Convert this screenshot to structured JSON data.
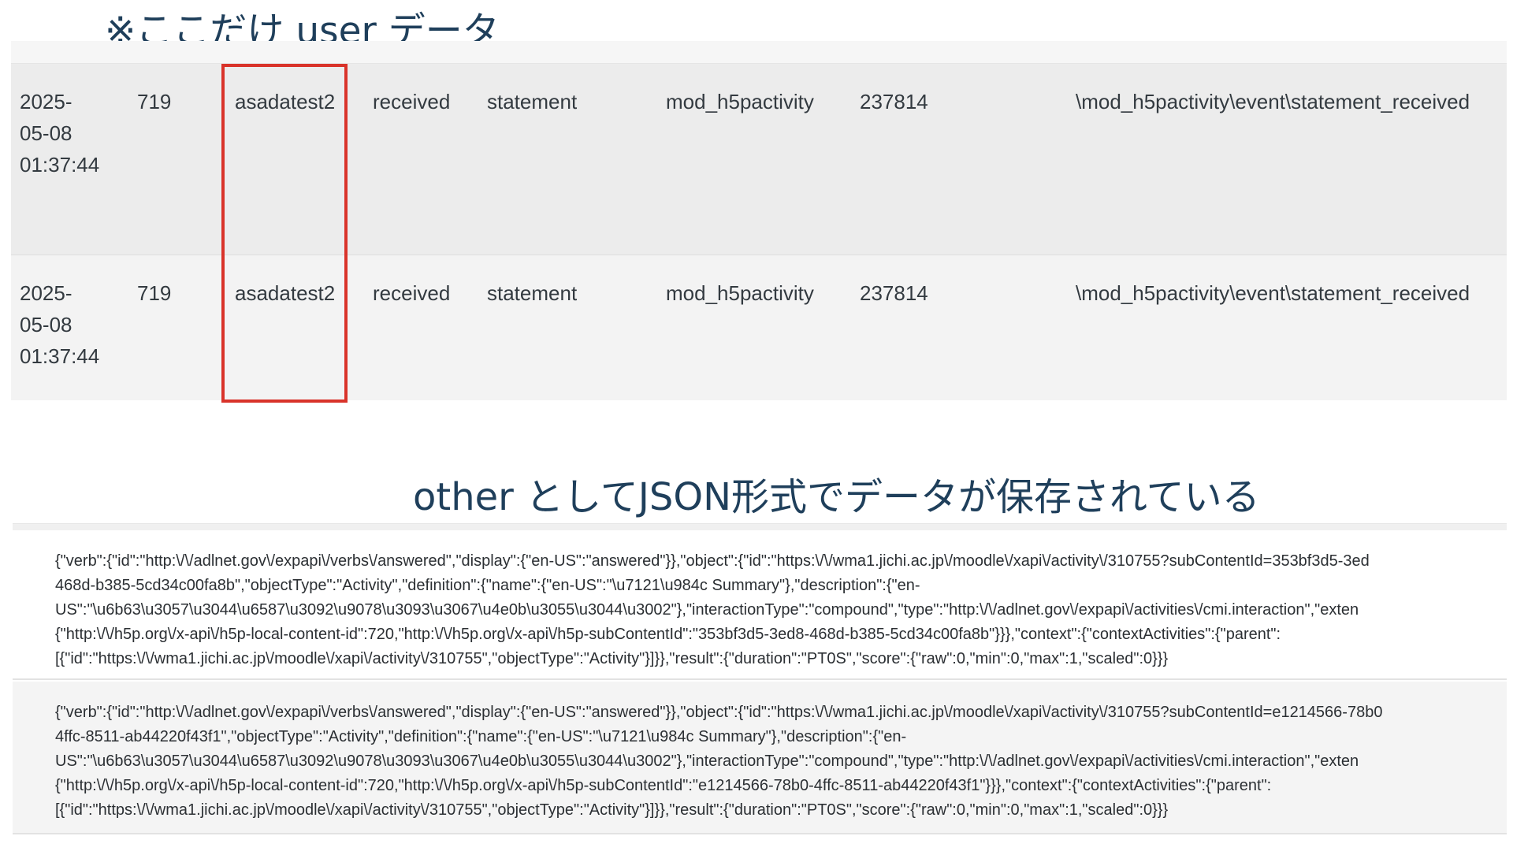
{
  "annotations": {
    "top_caption": "※ここだけ user データ",
    "middle_caption": "other としてJSON形式でデータが保存されている"
  },
  "log_rows": [
    {
      "time": [
        "2025-",
        "05-08",
        "01:37:44"
      ],
      "user_id": "719",
      "username": "asadatest2",
      "action": "received",
      "target": "statement",
      "component": "mod_h5pactivity",
      "object_id": "237814",
      "event_name": "\\mod_h5pactivity\\event\\statement_received"
    },
    {
      "time": [
        "2025-",
        "05-08",
        "01:37:44"
      ],
      "user_id": "719",
      "username": "asadatest2",
      "action": "received",
      "target": "statement",
      "component": "mod_h5pactivity",
      "object_id": "237814",
      "event_name": "\\mod_h5pactivity\\event\\statement_received"
    }
  ],
  "other_rows": [
    {
      "lines": [
        "{\"verb\":{\"id\":\"http:\\/\\/adlnet.gov\\/expapi\\/verbs\\/answered\",\"display\":{\"en-US\":\"answered\"}},\"object\":{\"id\":\"https:\\/\\/wma1.jichi.ac.jp\\/moodle\\/xapi\\/activity\\/310755?subContentId=353bf3d5-3ed",
        "468d-b385-5cd34c00fa8b\",\"objectType\":\"Activity\",\"definition\":{\"name\":{\"en-US\":\"\\u7121\\u984c Summary\"},\"description\":{\"en-",
        "US\":\"\\u6b63\\u3057\\u3044\\u6587\\u3092\\u9078\\u3093\\u3067\\u4e0b\\u3055\\u3044\\u3002\"},\"interactionType\":\"compound\",\"type\":\"http:\\/\\/adlnet.gov\\/expapi\\/activities\\/cmi.interaction\",\"exten",
        "{\"http:\\/\\/h5p.org\\/x-api\\/h5p-local-content-id\":720,\"http:\\/\\/h5p.org\\/x-api\\/h5p-subContentId\":\"353bf3d5-3ed8-468d-b385-5cd34c00fa8b\"}}},\"context\":{\"contextActivities\":{\"parent\":",
        "[{\"id\":\"https:\\/\\/wma1.jichi.ac.jp\\/moodle\\/xapi\\/activity\\/310755\",\"objectType\":\"Activity\"}]}},\"result\":{\"duration\":\"PT0S\",\"score\":{\"raw\":0,\"min\":0,\"max\":1,\"scaled\":0}}}"
      ]
    },
    {
      "lines": [
        "{\"verb\":{\"id\":\"http:\\/\\/adlnet.gov\\/expapi\\/verbs\\/answered\",\"display\":{\"en-US\":\"answered\"}},\"object\":{\"id\":\"https:\\/\\/wma1.jichi.ac.jp\\/moodle\\/xapi\\/activity\\/310755?subContentId=e1214566-78b0",
        "4ffc-8511-ab44220f43f1\",\"objectType\":\"Activity\",\"definition\":{\"name\":{\"en-US\":\"\\u7121\\u984c Summary\"},\"description\":{\"en-",
        "US\":\"\\u6b63\\u3057\\u3044\\u6587\\u3092\\u9078\\u3093\\u3067\\u4e0b\\u3055\\u3044\\u3002\"},\"interactionType\":\"compound\",\"type\":\"http:\\/\\/adlnet.gov\\/expapi\\/activities\\/cmi.interaction\",\"exten",
        "{\"http:\\/\\/h5p.org\\/x-api\\/h5p-local-content-id\":720,\"http:\\/\\/h5p.org\\/x-api\\/h5p-subContentId\":\"e1214566-78b0-4ffc-8511-ab44220f43f1\"}}},\"context\":{\"contextActivities\":{\"parent\":",
        "[{\"id\":\"https:\\/\\/wma1.jichi.ac.jp\\/moodle\\/xapi\\/activity\\/310755\",\"objectType\":\"Activity\"}]}},\"result\":{\"duration\":\"PT0S\",\"score\":{\"raw\":0,\"min\":0,\"max\":1,\"scaled\":0}}}"
      ]
    }
  ],
  "colors": {
    "caption_text": "#1f3f5b",
    "highlight_border": "#d9332a",
    "row_bg_1": "#ececec",
    "row_bg_2": "#f3f3f3",
    "cell_text": "#333a40"
  }
}
